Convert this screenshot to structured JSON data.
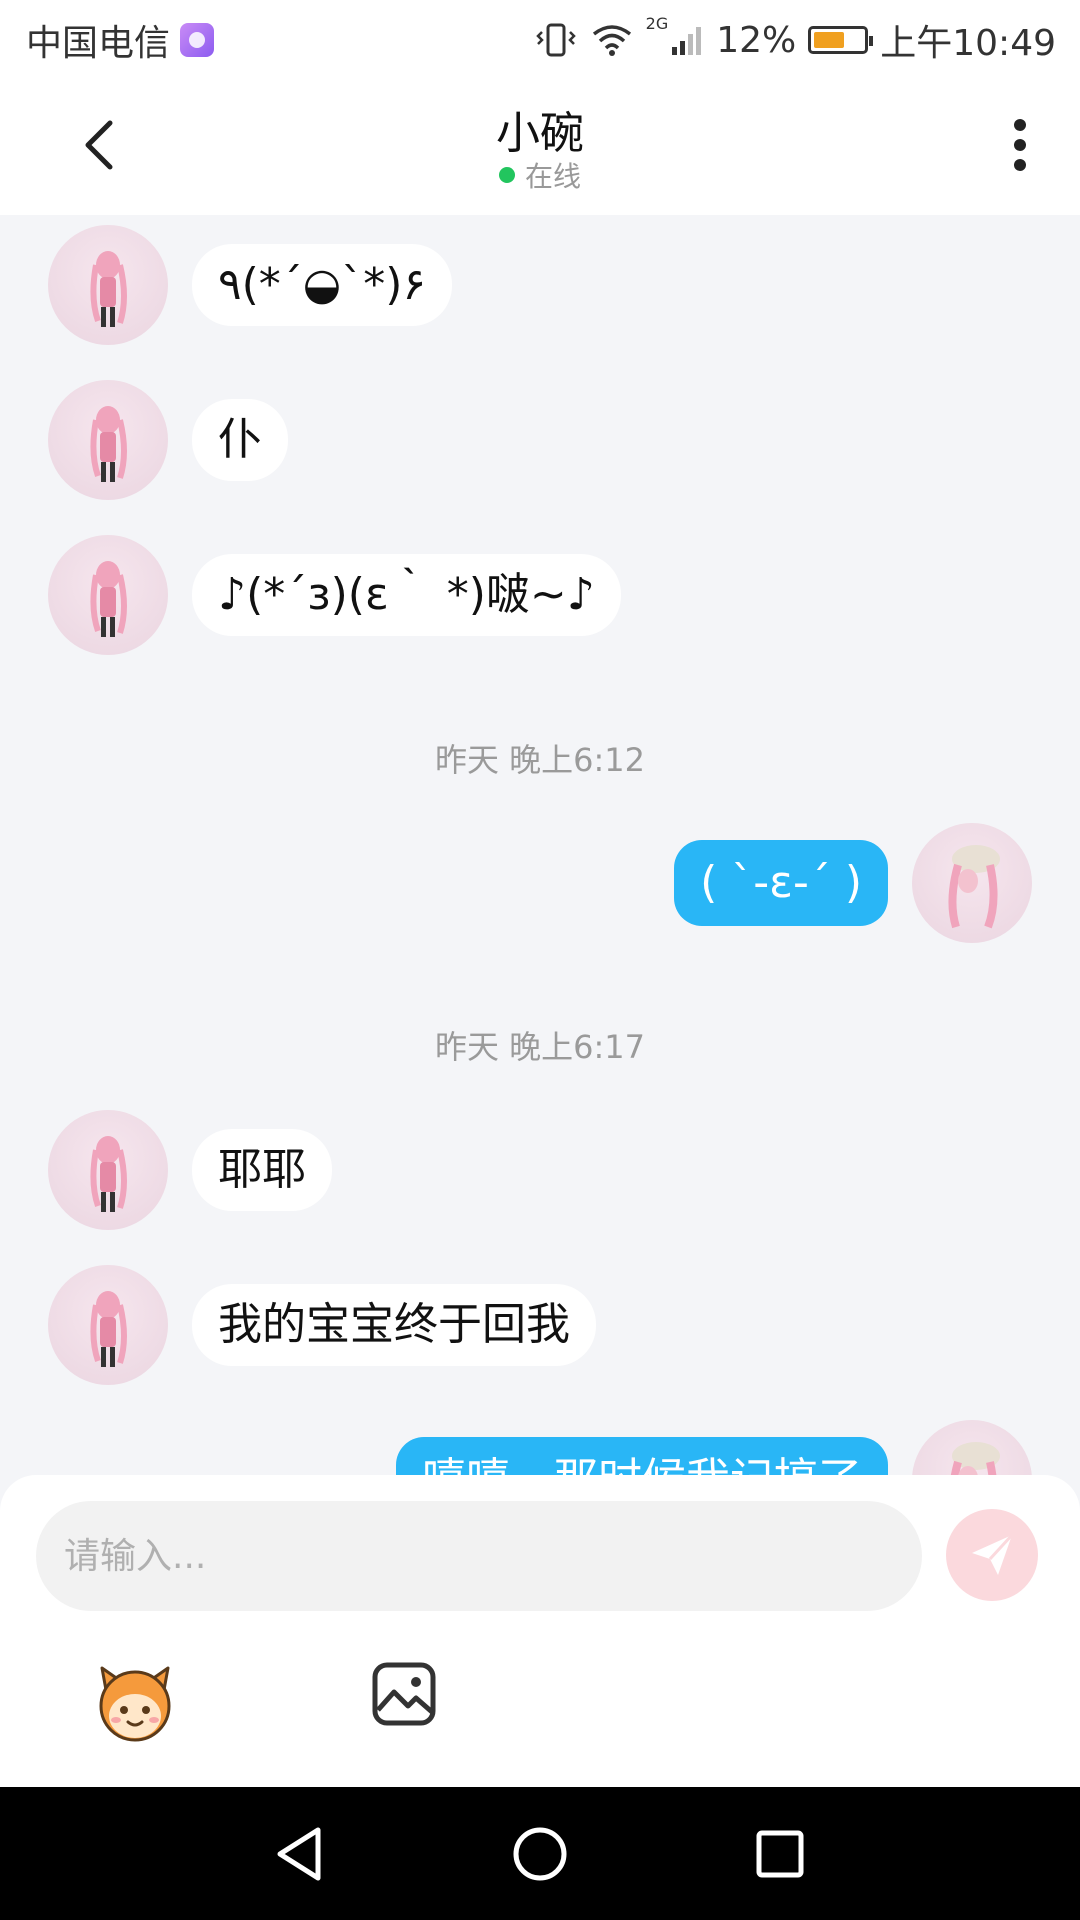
{
  "status_bar": {
    "carrier": "中国电信",
    "network": "2G",
    "battery": "12%",
    "time": "上午10:49"
  },
  "header": {
    "title": "小碗",
    "status": "在线"
  },
  "messages": [
    {
      "side": "left",
      "text": "٩(*´◒`*)۶"
    },
    {
      "side": "left",
      "text": "仆"
    },
    {
      "side": "left",
      "text": "♪(*´з)(ε｀ *)啵~♪"
    },
    {
      "type": "time",
      "text": "昨天 晚上6:12"
    },
    {
      "side": "right",
      "text": "( ˋ-ε-ˊ )"
    },
    {
      "type": "time",
      "text": "昨天 晚上6:17"
    },
    {
      "side": "left",
      "text": "耶耶"
    },
    {
      "side": "left",
      "text": "我的宝宝终于回我"
    },
    {
      "side": "right",
      "text": "嘻嘻，那时候我记搞了"
    }
  ],
  "composer": {
    "placeholder": "请输入..."
  },
  "icons": {
    "back": "chevron-left-icon",
    "more": "more-vertical-icon",
    "send": "paper-plane-icon",
    "emoji": "mascot-emoji-icon",
    "image": "image-icon",
    "nav_back": "triangle-back-icon",
    "nav_home": "circle-home-icon",
    "nav_recent": "square-recent-icon"
  },
  "colors": {
    "accent_blue": "#29b6f6",
    "online_green": "#22c55e",
    "send_disabled": "#fbd9dd",
    "chat_background": "#f4f5f8"
  }
}
